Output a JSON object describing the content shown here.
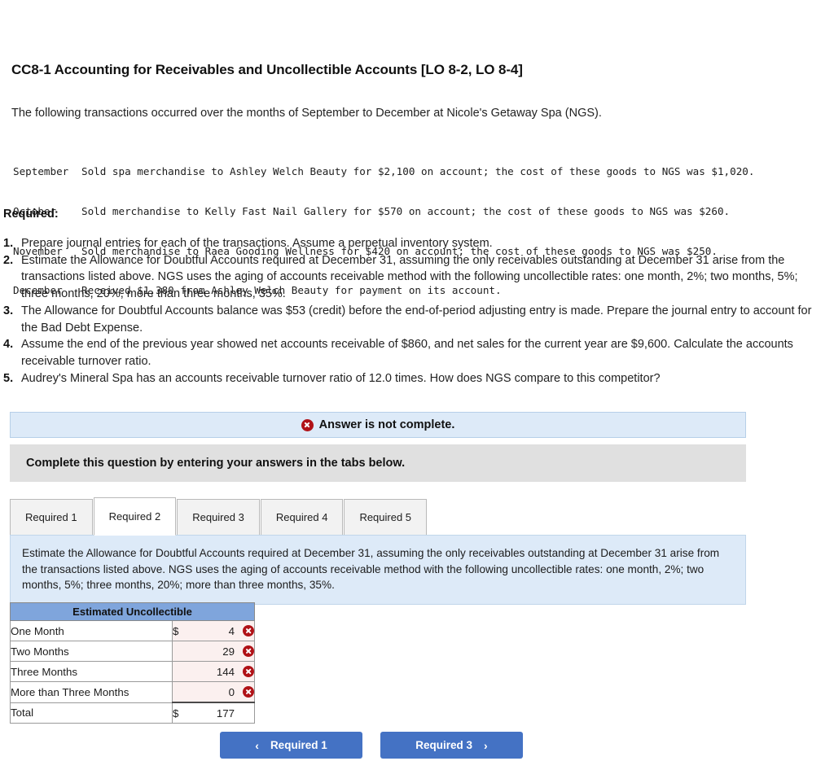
{
  "problem": {
    "title": "CC8-1 Accounting for Receivables and Uncollectible Accounts [LO 8-2, LO 8-4]",
    "intro": "The following transactions occurred over the months of September to December at Nicole's Getaway Spa (NGS).",
    "transactions": [
      {
        "month": "September",
        "description": "Sold spa merchandise to Ashley Welch Beauty for $2,100 on account; the cost of these goods to NGS was $1,020."
      },
      {
        "month": "October",
        "description": "Sold merchandise to Kelly Fast Nail Gallery for $570 on account; the cost of these goods to NGS was $260."
      },
      {
        "month": "November",
        "description": "Sold merchandise to Raea Gooding Wellness for $420 on account; the cost of these goods to NGS was $250."
      },
      {
        "month": "December",
        "description": "Received $1,380 from Ashley Welch Beauty for payment on its account."
      }
    ],
    "required_heading": "Required:",
    "requirements": [
      {
        "num": "1.",
        "text": "Prepare journal entries for each of the transactions. Assume a perpetual inventory system."
      },
      {
        "num": "2.",
        "text": "Estimate the Allowance for Doubtful Accounts required at December 31, assuming the only receivables outstanding at December 31 arise from the transactions listed above. NGS uses the aging of accounts receivable method with the following uncollectible rates: one month, 2%; two months, 5%; three months, 20%; more than three months, 35%."
      },
      {
        "num": "3.",
        "text": "The Allowance for Doubtful Accounts balance was $53 (credit) before the end-of-period adjusting entry is made. Prepare the journal entry to account for the Bad Debt Expense."
      },
      {
        "num": "4.",
        "text": "Assume the end of the previous year showed net accounts receivable of $860, and net sales for the current year are $9,600. Calculate the accounts receivable turnover ratio."
      },
      {
        "num": "5.",
        "text": "Audrey's Mineral Spa has an accounts receivable turnover ratio of 12.0 times. How does NGS compare to this competitor?"
      }
    ]
  },
  "status_banner": {
    "icon": "error-x-icon",
    "text": "Answer is not complete.",
    "background_color": "#ddeaf8",
    "icon_color": "#b01217"
  },
  "instruction_banner": {
    "text": "Complete this question by entering your answers in the tabs below.",
    "background_color": "#e0e0e0"
  },
  "tabs": [
    {
      "label": "Required 1",
      "active": false
    },
    {
      "label": "Required 2",
      "active": true
    },
    {
      "label": "Required 3",
      "active": false
    },
    {
      "label": "Required 4",
      "active": false
    },
    {
      "label": "Required 5",
      "active": false
    }
  ],
  "question_panel": {
    "text": "Estimate the Allowance for Doubtful Accounts required at December 31, assuming the only receivables outstanding at December 31 arise from the transactions listed above. NGS uses the aging of accounts receivable method with the following uncollectible rates: one month, 2%; two months, 5%; three months, 20%; more than three months, 35%.",
    "background_color": "#ddeaf8"
  },
  "answer_table": {
    "header": "Estimated Uncollectible",
    "header_color": "#7fa5dc",
    "rows": [
      {
        "label": "One Month",
        "currency": "$",
        "value": "4",
        "mark": "incorrect-icon"
      },
      {
        "label": "Two Months",
        "currency": "",
        "value": "29",
        "mark": "incorrect-icon"
      },
      {
        "label": "Three Months",
        "currency": "",
        "value": "144",
        "mark": "incorrect-icon"
      },
      {
        "label": "More than Three Months",
        "currency": "",
        "value": "0",
        "mark": "incorrect-icon"
      }
    ],
    "total_row": {
      "label": "Total",
      "currency": "$",
      "value": "177",
      "mark": ""
    }
  },
  "navigation": {
    "prev_label": "Required 1",
    "prev_chevron": "‹",
    "next_label": "Required 3",
    "next_chevron": "›",
    "button_color": "#4472c4"
  }
}
